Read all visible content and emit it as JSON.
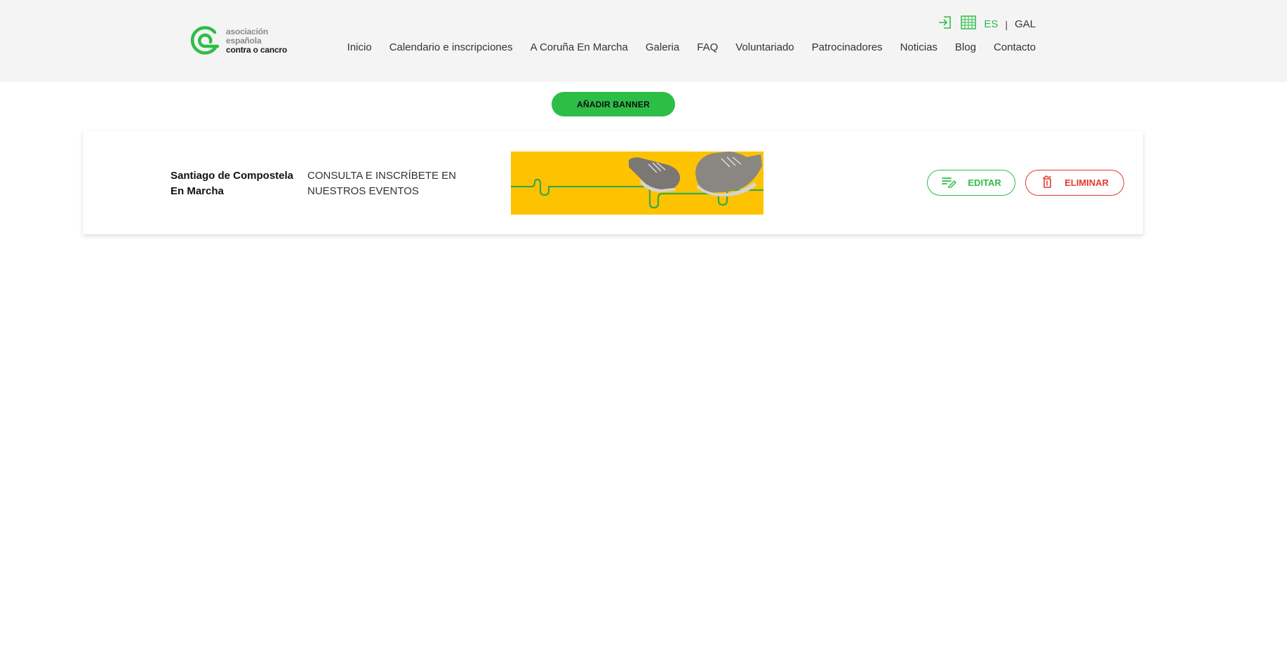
{
  "brand": {
    "logo_line1": "asociación",
    "logo_line2": "española",
    "logo_line3": "contra o cancro",
    "green": "#2dbe47",
    "red": "#e53935",
    "yellow": "#fdc300"
  },
  "topbar": {
    "login_icon": "login-icon",
    "calendar_icon": "calendar-grid-icon",
    "lang_es": "ES",
    "lang_separator": "|",
    "lang_gal": "GAL"
  },
  "nav": {
    "items": [
      "Inicio",
      "Calendario e inscripciones",
      "A Coruña En Marcha",
      "Galeria",
      "FAQ",
      "Voluntariado",
      "Patrocinadores",
      "Noticias",
      "Blog",
      "Contacto"
    ]
  },
  "actions": {
    "add_banner_label": "AÑADIR BANNER"
  },
  "banner": {
    "title": "Santiago de Compostela En Marcha",
    "subtitle": "CONSULTA E INSCRÍBETE EN NUESTROS EVENTOS",
    "edit_label": "EDITAR",
    "delete_label": "ELIMINAR",
    "edit_icon": "edit-list-icon",
    "delete_icon": "trash-icon"
  }
}
